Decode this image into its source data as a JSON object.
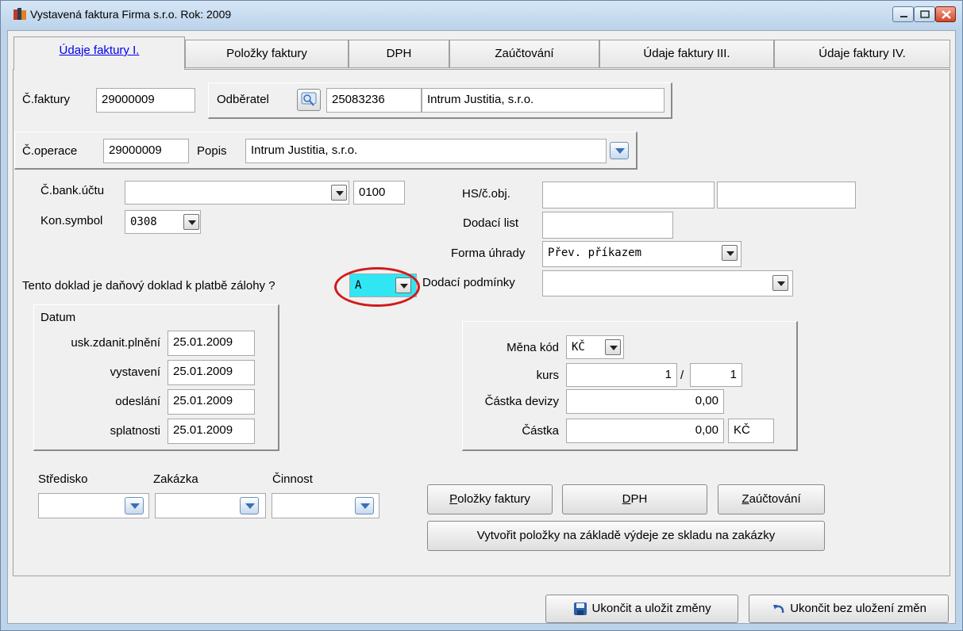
{
  "window": {
    "title": "Vystavená faktura  Firma s.r.o.  Rok: 2009"
  },
  "tabs": [
    {
      "label": "Údaje faktury I."
    },
    {
      "label": "Položky faktury"
    },
    {
      "label": "DPH"
    },
    {
      "label": "Zaúčtování"
    },
    {
      "label": "Údaje faktury III."
    },
    {
      "label": "Údaje faktury IV."
    }
  ],
  "invoice": {
    "number_label": "Č.faktury",
    "number": "29000009",
    "customer_label": "Odběratel",
    "customer_id": "25083236",
    "customer_name": "Intrum Justitia, s.r.o."
  },
  "operation": {
    "number_label": "Č.operace",
    "number": "29000009",
    "description_label": "Popis",
    "description": "Intrum Justitia, s.r.o."
  },
  "bank": {
    "account_label": "Č.bank.účtu",
    "account": "",
    "bank_code": "0100",
    "const_symbol_label": "Kon.symbol",
    "const_symbol": "0308"
  },
  "right_fields": {
    "order_label": "HS/č.obj.",
    "order_a": "",
    "order_b": "",
    "delivery_note_label": "Dodací list",
    "delivery_note": "",
    "payment_form_label": "Forma úhrady",
    "payment_form": "Přev. příkazem",
    "delivery_terms_label": "Dodací podmínky",
    "delivery_terms": ""
  },
  "advance": {
    "question": "Tento doklad je daňový doklad k platbě zálohy ?",
    "value": "A"
  },
  "dates": {
    "group_label": "Datum",
    "taxable_label": "usk.zdanit.plnění",
    "taxable": "25.01.2009",
    "issued_label": "vystavení",
    "issued": "25.01.2009",
    "sent_label": "odeslání",
    "sent": "25.01.2009",
    "due_label": "splatnosti",
    "due": "25.01.2009"
  },
  "currency": {
    "code_label": "Měna kód",
    "code": "KČ",
    "rate_label": "kurs",
    "rate_a": "1",
    "rate_sep": "/",
    "rate_b": "1",
    "foreign_label": "Částka devizy",
    "foreign_amount": "0,00",
    "amount_label": "Částka",
    "amount": "0,00",
    "amount_currency": "KČ"
  },
  "dims": {
    "center_label": "Středisko",
    "order_label": "Zakázka",
    "activity_label": "Činnost"
  },
  "actions": {
    "items_prefix": "",
    "items_key": "P",
    "items_rest": "oložky faktury",
    "vat_key": "D",
    "vat_rest": "PH",
    "posting_prefix": "",
    "posting_key": "Z",
    "posting_rest": "aúčtování",
    "create_items": "Vytvořit položky na základě výdeje ze skladu na zakázky"
  },
  "footer": {
    "save": "Ukončit a uložit změny",
    "cancel": "Ukončit bez uložení změn"
  }
}
